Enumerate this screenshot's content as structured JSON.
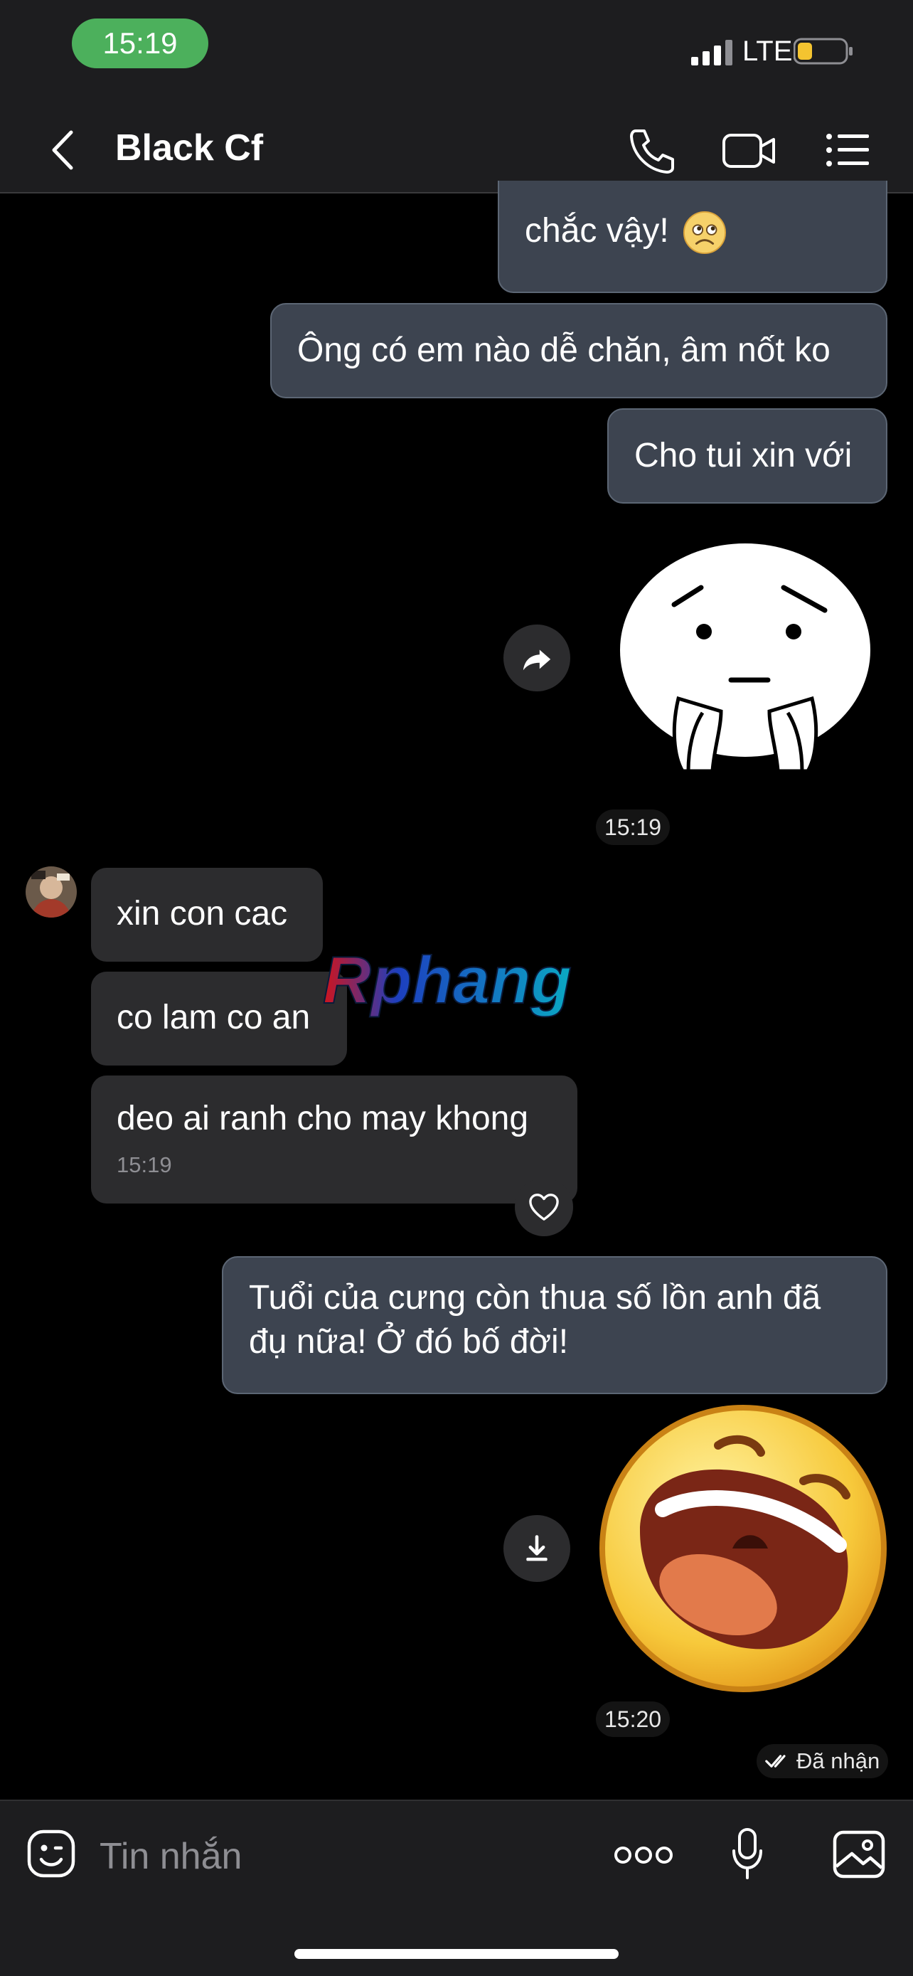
{
  "status_bar": {
    "time": "15:19",
    "network": "LTE"
  },
  "header": {
    "title": "Black Cf"
  },
  "messages": {
    "out_1": "chắc vậy!",
    "out_2": "Ông có em nào dễ chăn, âm nốt ko",
    "out_3": "Cho tui xin với",
    "sticker_1_time": "15:19",
    "in_1": "xin con cac",
    "in_2": "co lam co an",
    "in_3": "deo ai ranh cho may khong",
    "in_3_time": "15:19",
    "out_4": "Tuổi của cưng còn thua số lồn anh đã đụ nữa! Ở đó bố đời!",
    "sticker_2_time": "15:20",
    "delivery_status": "Đã nhận"
  },
  "watermark": {
    "text": "Rphang"
  },
  "composer": {
    "placeholder": "Tin nhắn"
  },
  "colors": {
    "outgoing_bubble": "#3d4450",
    "incoming_bubble": "#2c2c2e",
    "time_pill": "#4cb05c"
  },
  "icons": [
    "back-icon",
    "phone-icon",
    "video-camera-icon",
    "list-menu-icon",
    "forward-icon",
    "heart-icon",
    "download-icon",
    "emoji-icon",
    "more-options-icon",
    "microphone-icon",
    "image-icon",
    "double-check-icon"
  ]
}
